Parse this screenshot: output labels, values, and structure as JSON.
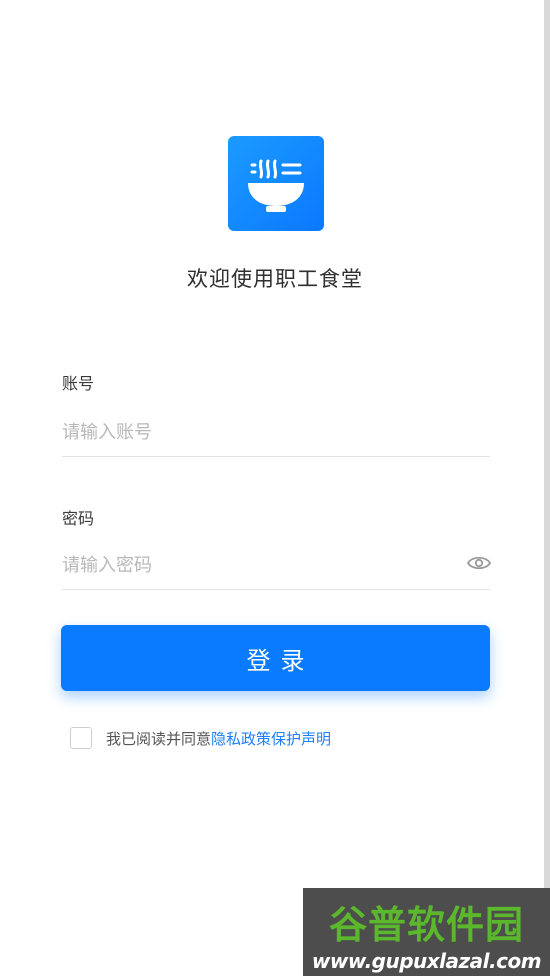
{
  "app": {
    "logo_icon": "bowl-noodle-icon",
    "welcome_title": "欢迎使用职工食堂"
  },
  "form": {
    "account": {
      "label": "账号",
      "placeholder": "请输入账号",
      "value": ""
    },
    "password": {
      "label": "密码",
      "placeholder": "请输入密码",
      "value": "",
      "visibility_icon": "eye-icon"
    },
    "login_label": "登录",
    "agreement": {
      "checked": false,
      "text": "我已阅读并同意",
      "link": "隐私政策保护声明"
    }
  },
  "watermark": {
    "title": "谷普软件园",
    "url": "www.gupuxlazal.com"
  },
  "colors": {
    "primary": "#0a7bff",
    "link": "#1f7fff",
    "watermark_green": "#5bb82d"
  }
}
